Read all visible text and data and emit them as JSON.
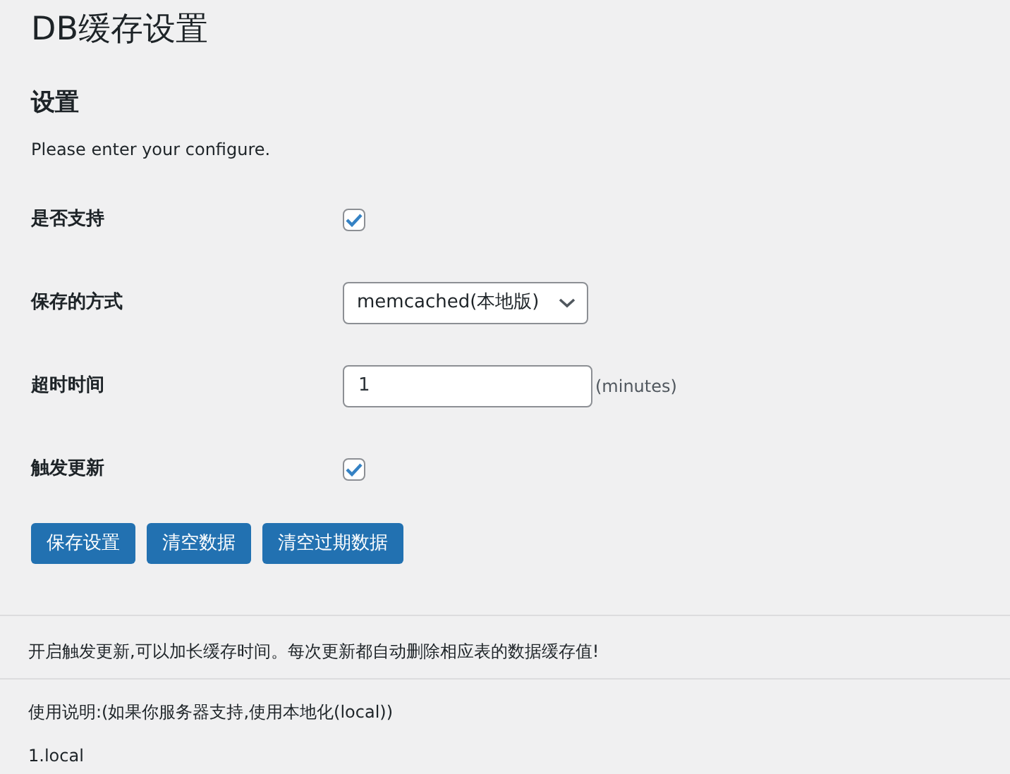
{
  "title": "DB缓存设置",
  "section_title": "设置",
  "description": "Please enter your configure.",
  "fields": [
    {
      "label": "是否支持",
      "kind": "checkbox",
      "checked": true
    },
    {
      "label": "保存的方式",
      "kind": "select",
      "value": "memcached(本地版)"
    },
    {
      "label": "超时时间",
      "kind": "text",
      "value": "1",
      "suffix": "(minutes)"
    },
    {
      "label": "触发更新",
      "kind": "checkbox",
      "checked": true
    }
  ],
  "buttons": [
    "保存设置",
    "清空数据",
    "清空过期数据"
  ],
  "note": "开启触发更新,可以加长缓存时间。每次更新都自动删除相应表的数据缓存值!",
  "usage": "使用说明:(如果你服务器支持,使用本地化(local))",
  "usage_items": [
    "1.local"
  ]
}
